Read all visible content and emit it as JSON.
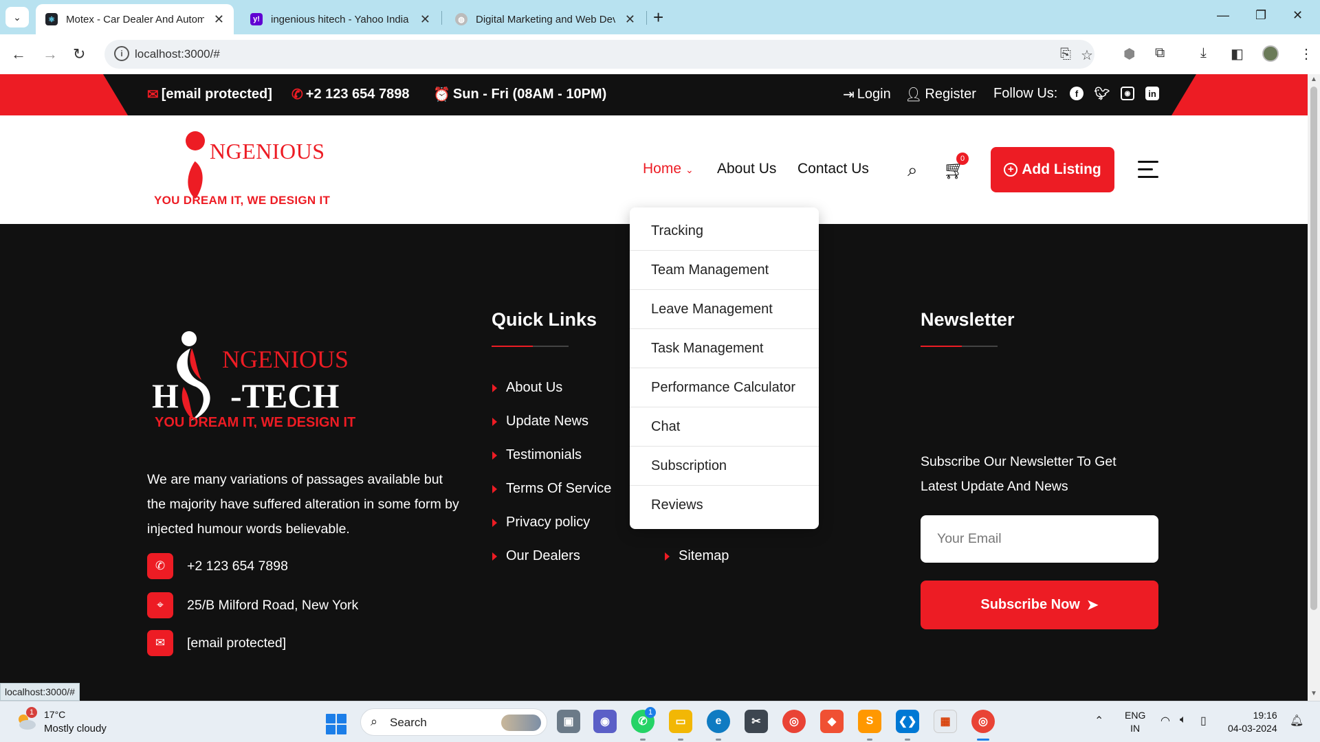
{
  "browser": {
    "tabs": [
      {
        "title": "Motex - Car Dealer And Automotive",
        "favicon": "react-icon"
      },
      {
        "title": "ingenious hitech - Yahoo India Search",
        "favicon": "yahoo-icon"
      },
      {
        "title": "Digital Marketing and Web Development",
        "favicon": "globe-icon"
      }
    ],
    "url": "localhost:3000/#"
  },
  "topbar": {
    "email": "[email protected]",
    "phone": "+2 123 654 7898",
    "hours": "Sun - Fri (08AM - 10PM)",
    "login": "Login",
    "register": "Register",
    "follow_label": "Follow Us:",
    "social": [
      "facebook-icon",
      "twitter-icon",
      "instagram-icon",
      "linkedin-icon"
    ]
  },
  "header": {
    "logo_word": "NGENIOUS",
    "logo_tagline": "YOU DREAM IT, WE DESIGN IT",
    "nav": {
      "home": "Home",
      "about": "About Us",
      "contact": "Contact Us"
    },
    "cart_count": "0",
    "add_listing": "Add Listing"
  },
  "home_dropdown": [
    "Tracking",
    "Team Management",
    "Leave Management",
    "Task Management",
    "Performance Calculator",
    "Chat",
    "Subscription",
    "Reviews"
  ],
  "footer": {
    "logo_word": "NGENIOUS",
    "logo_sub": "H",
    "logo_tech": "-TECH",
    "logo_tagline": "YOU DREAM IT, WE DESIGN IT",
    "description": "We are many variations of passages available but the majority have suffered alteration in some form by injected humour words believable.",
    "phone": "+2 123 654 7898",
    "address": "25/B Milford Road, New York",
    "email": "[email protected]",
    "quick_links_title": "Quick Links",
    "quick_links": [
      "About Us",
      "Update News",
      "Testimonials",
      "Terms Of Service",
      "Privacy policy",
      "Our Dealers"
    ],
    "extra_link": "Sitemap",
    "newsletter_title": "Newsletter",
    "newsletter_text": "Subscribe Our Newsletter To Get Latest Update And News",
    "newsletter_placeholder": "Your Email",
    "subscribe_label": "Subscribe Now"
  },
  "status_url": "localhost:3000/#",
  "taskbar": {
    "weather_temp": "17°C",
    "weather_cond": "Mostly cloudy",
    "weather_badge": "1",
    "search_label": "Search",
    "whatsapp_badge": "1",
    "lang_top": "ENG",
    "lang_bottom": "IN",
    "time": "19:16",
    "date": "04-03-2024"
  },
  "colors": {
    "accent": "#ed1c24",
    "dark": "#111111"
  }
}
